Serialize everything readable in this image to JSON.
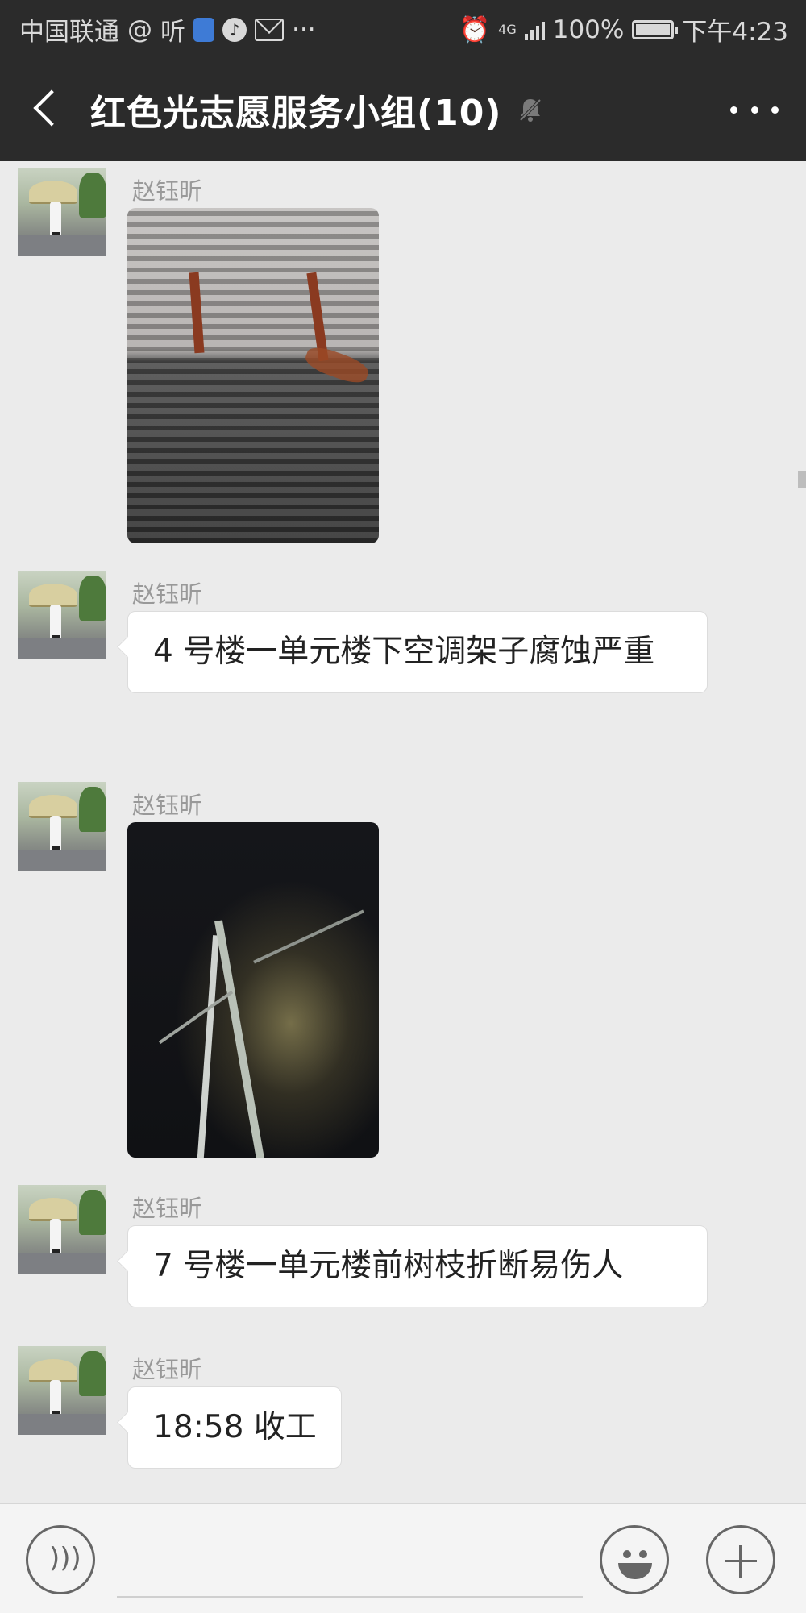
{
  "status_bar": {
    "carrier": "中国联通",
    "app_text": "听",
    "more": "···",
    "network": "4G",
    "battery": "100%",
    "time": "下午4:23"
  },
  "header": {
    "back_icon": "chevron-left-icon",
    "title": "红色光志愿服务小组(10)",
    "mute_icon": "bell-muted-icon",
    "more_icon": "more-dots-icon"
  },
  "messages": [
    {
      "type": "image",
      "sender": "赵钰昕"
    },
    {
      "type": "text",
      "sender": "赵钰昕",
      "text": "4 号楼一单元楼下空调架子腐蚀严重"
    },
    {
      "type": "image",
      "sender": "赵钰昕"
    },
    {
      "type": "text",
      "sender": "赵钰昕",
      "text": "7 号楼一单元楼前树枝折断易伤人"
    },
    {
      "type": "text",
      "sender": "赵钰昕",
      "text": "18:58 收工"
    }
  ],
  "input_bar": {
    "voice_icon": "voice-icon",
    "emoji_icon": "emoji-icon",
    "plus_icon": "plus-icon"
  },
  "colors": {
    "header_bg": "#2b2b2b",
    "chat_bg": "#ebebeb",
    "bubble_bg": "#ffffff",
    "sender_text": "#999999"
  }
}
